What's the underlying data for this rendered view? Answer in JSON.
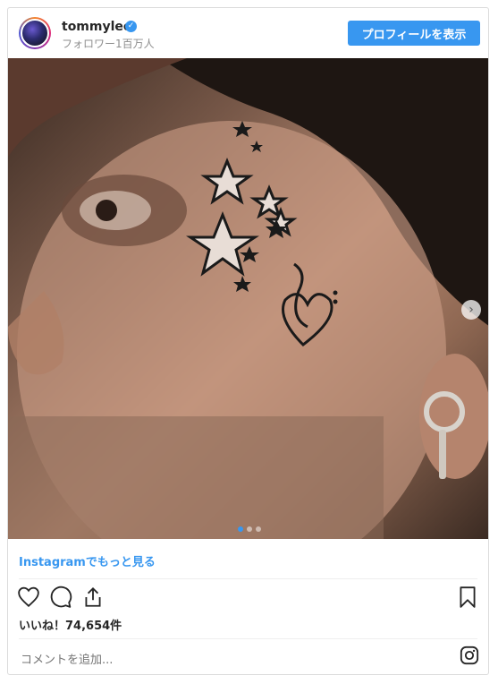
{
  "header": {
    "username": "tommylee",
    "followers": "フォロワー1百万人",
    "profile_button": "プロフィールを表示"
  },
  "post": {
    "more_link": "Instagramでもっと見る",
    "likes": "いいね！74,654件",
    "comment_placeholder": "コメントを追加...",
    "carousel": {
      "count": 3,
      "active_index": 0
    }
  },
  "colors": {
    "accent": "#3897f0",
    "text": "#262626",
    "muted": "#8e8e8e",
    "border": "#dbdbdb"
  },
  "icons": {
    "like": "heart-icon",
    "comment": "comment-icon",
    "share": "share-icon",
    "save": "bookmark-icon",
    "instagram": "instagram-icon",
    "next": "chevron-right-icon"
  }
}
